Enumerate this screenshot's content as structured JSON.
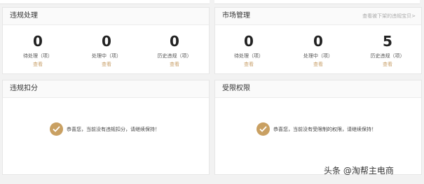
{
  "left_panel": {
    "title": "违规处理",
    "stats": [
      {
        "value": "0",
        "label": "待处理（项）",
        "view": "查看"
      },
      {
        "value": "0",
        "label": "处理中（项）",
        "view": "查看"
      },
      {
        "value": "0",
        "label": "历史违规（项）",
        "view": "查看"
      }
    ]
  },
  "right_panel": {
    "title": "市场管理",
    "link": "查看被下架的违规宝贝>",
    "stats": [
      {
        "value": "0",
        "label": "待处理（项）",
        "view": "查看"
      },
      {
        "value": "0",
        "label": "处理中（项）",
        "view": "查看"
      },
      {
        "value": "5",
        "label": "历史违规（项）",
        "view": "查看"
      }
    ]
  },
  "deduction_panel": {
    "title": "违规扣分",
    "message": "恭喜您，当前没有违规扣分，请继续保持！"
  },
  "restriction_panel": {
    "title": "受限权限",
    "message": "恭喜您，当前没有受限制的权限，请继续保持！"
  },
  "watermark": "头条 @淘帮主电商"
}
